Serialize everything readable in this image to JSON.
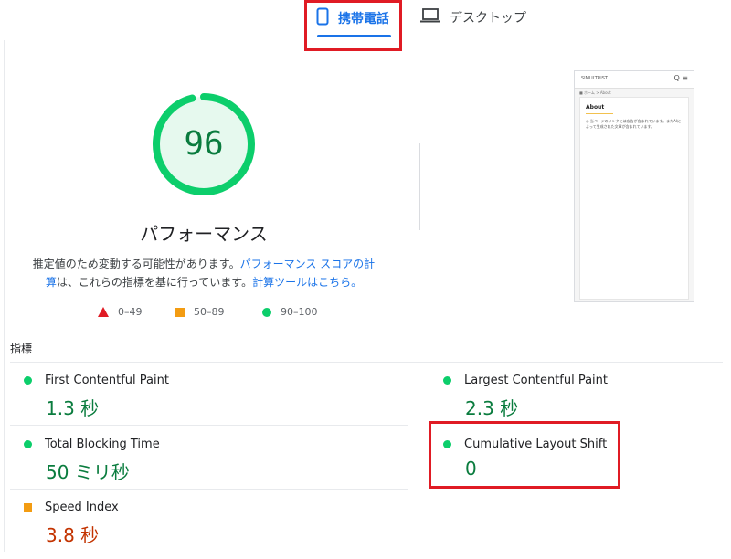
{
  "tabs": {
    "mobile": {
      "label": "携帯電話",
      "icon": "smartphone-icon"
    },
    "desktop": {
      "label": "デスクトップ",
      "icon": "laptop-icon"
    }
  },
  "gauge": {
    "score": "96",
    "title": "パフォーマンス",
    "color": "#0cce6b"
  },
  "description": {
    "text1": "推定値のため変動する可能性があります。",
    "link1": "パフォーマンス スコアの計算",
    "text2": "は、これらの指標を基に行っています。",
    "link2": "計算ツールはこちら。"
  },
  "legend": [
    {
      "range": "0–49",
      "icon": "triangle-icon",
      "color": "#e01b24"
    },
    {
      "range": "50–89",
      "icon": "square-icon",
      "color": "#f39c12"
    },
    {
      "range": "90–100",
      "icon": "circle-icon",
      "color": "#0cce6b"
    }
  ],
  "screenshot": {
    "logo": "SIMULTRIST",
    "icons": "Q ≡",
    "breadcrumb": "■ ホーム > About",
    "card_title": "About",
    "card_text": "◎ 当ページのリンクには広告が含まれています。またAIによって生成された文章が含まれています。"
  },
  "metrics": {
    "title": "指標",
    "items": [
      {
        "label": "First Contentful Paint",
        "value": "1.3 秒",
        "status": "good"
      },
      {
        "label": "Largest Contentful Paint",
        "value": "2.3 秒",
        "status": "good"
      },
      {
        "label": "Total Blocking Time",
        "value": "50 ミリ秒",
        "status": "good"
      },
      {
        "label": "Cumulative Layout Shift",
        "value": "0",
        "status": "good"
      },
      {
        "label": "Speed Index",
        "value": "3.8 秒",
        "status": "average"
      }
    ]
  },
  "colors": {
    "accent": "#1a73e8",
    "good": "#0cce6b",
    "average": "#f39c12",
    "poor": "#e01b24",
    "highlight": "#e01b24"
  }
}
